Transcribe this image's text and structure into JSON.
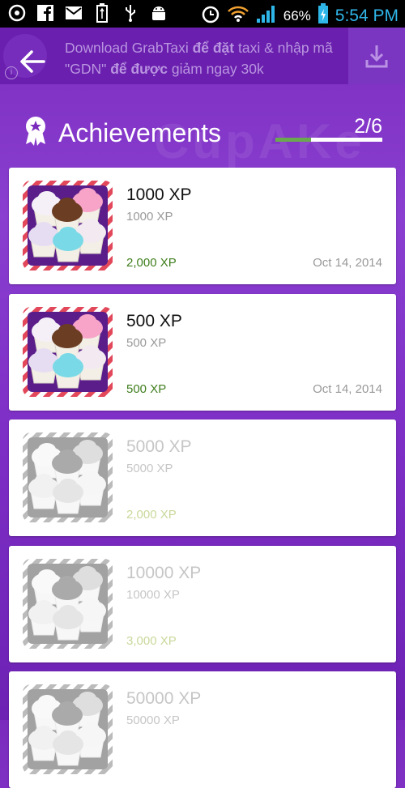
{
  "status_bar": {
    "battery_percent": "66%",
    "time": "5:54 PM",
    "icons": [
      "clock-face-icon",
      "facebook-icon",
      "mail-icon",
      "usb-battery-icon",
      "usb-icon",
      "android-bug-icon",
      "alarm-icon",
      "wifi-icon",
      "signal-icon",
      "battery-charging-icon"
    ]
  },
  "ad": {
    "line_parts": [
      {
        "text": "Download GrabTaxi ",
        "bold": false
      },
      {
        "text": "để đặt",
        "bold": true
      },
      {
        "text": " taxi & nhập mã \"GDN\" ",
        "bold": false
      },
      {
        "text": "để được",
        "bold": true
      },
      {
        "text": " giảm ngay 30k",
        "bold": false
      }
    ],
    "info_glyph": "i"
  },
  "header": {
    "title": "Achievements",
    "progress_label": "2/6",
    "progress_fraction": 0.333,
    "watermark": "CupAKe"
  },
  "achievements": [
    {
      "name": "1000 XP",
      "description": "1000 XP",
      "xp": "2,000 XP",
      "date": "Oct 14, 2014",
      "unlocked": true
    },
    {
      "name": "500 XP",
      "description": "500 XP",
      "xp": "500 XP",
      "date": "Oct 14, 2014",
      "unlocked": true
    },
    {
      "name": "5000 XP",
      "description": "5000 XP",
      "xp": "2,000 XP",
      "date": "",
      "unlocked": false
    },
    {
      "name": "10000 XP",
      "description": "10000 XP",
      "xp": "3,000 XP",
      "date": "",
      "unlocked": false
    },
    {
      "name": "50000 XP",
      "description": "50000 XP",
      "xp": "",
      "date": "",
      "unlocked": false
    }
  ],
  "colors": {
    "accent_purple": "#7a2bbd",
    "xp_green": "#3f7e1c",
    "progress_green": "#6aa84f",
    "time_blue": "#2fb6e8"
  }
}
